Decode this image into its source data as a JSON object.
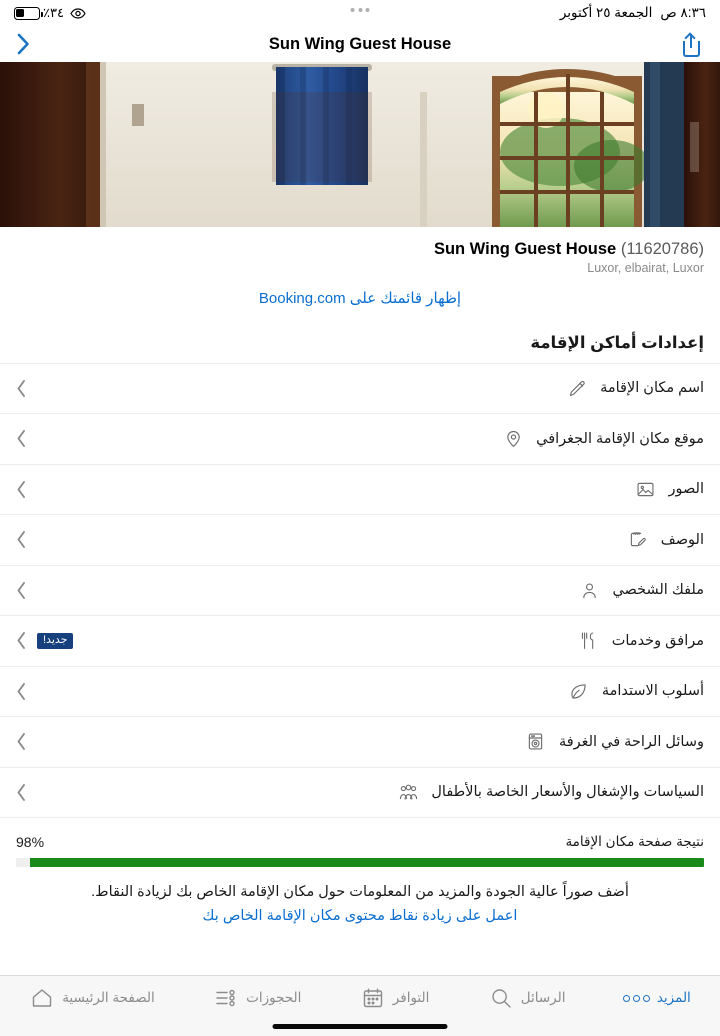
{
  "status_bar": {
    "battery_percent": "٪٣٤",
    "battery_level": 34,
    "eye_icon": "eye-icon",
    "time": "٨:٣٦ ص",
    "date": "الجمعة ٢٥ أكتوبر"
  },
  "navbar": {
    "share_icon": "share-icon",
    "title": "Sun Wing Guest House",
    "forward_icon": "chevron-right-icon"
  },
  "hero": {
    "alt": "صورة غرفة الفندق"
  },
  "property": {
    "name": "Sun Wing Guest House",
    "id": "(11620786)",
    "location": "Luxor, elbairat, Luxor",
    "listing_link": "إظهار قائمتك على Booking.com"
  },
  "settings": {
    "section_title": "إعدادات أماكن الإقامة",
    "items": [
      {
        "label": "اسم مكان الإقامة",
        "icon": "pencil-icon",
        "badge": ""
      },
      {
        "label": "موقع مكان الإقامة الجغرافي",
        "icon": "location-pin-icon",
        "badge": ""
      },
      {
        "label": "الصور",
        "icon": "photo-icon",
        "badge": ""
      },
      {
        "label": "الوصف",
        "icon": "clipboard-pencil-icon",
        "badge": ""
      },
      {
        "label": "ملفك الشخصي",
        "icon": "person-icon",
        "badge": ""
      },
      {
        "label": "مرافق وخدمات",
        "icon": "cutlery-icon",
        "badge": "جديد!"
      },
      {
        "label": "أسلوب الاستدامة",
        "icon": "leaf-icon",
        "badge": ""
      },
      {
        "label": "وسائل الراحة في الغرفة",
        "icon": "washing-machine-icon",
        "badge": ""
      },
      {
        "label": "السياسات والإشغال والأسعار الخاصة بالأطفال",
        "icon": "family-icon",
        "badge": ""
      }
    ],
    "chevron_icon": "chevron-left-icon"
  },
  "score": {
    "label": "نتيجة صفحة مكان الإقامة",
    "percent_text": "98%",
    "percent_value": 98,
    "bar_color": "#1a8a1a",
    "description": "أضف صوراً عالية الجودة والمزيد من المعلومات حول مكان الإقامة الخاص بك لزيادة النقاط.",
    "cta": "اعمل على زيادة نقاط محتوى مكان الإقامة الخاص بك"
  },
  "tabbar": {
    "active_color": "#1e74c4",
    "inactive_color": "#8c8c8c",
    "tabs": [
      {
        "label": "الصفحة الرئيسية",
        "icon": "home-icon",
        "active": false
      },
      {
        "label": "الحجوزات",
        "icon": "reservations-list-icon",
        "active": false
      },
      {
        "label": "التوافر",
        "icon": "calendar-icon",
        "active": false
      },
      {
        "label": "الرسائل",
        "icon": "search-messages-icon",
        "active": false
      },
      {
        "label": "المزيد",
        "icon": "more-dots-icon",
        "active": true
      }
    ]
  }
}
